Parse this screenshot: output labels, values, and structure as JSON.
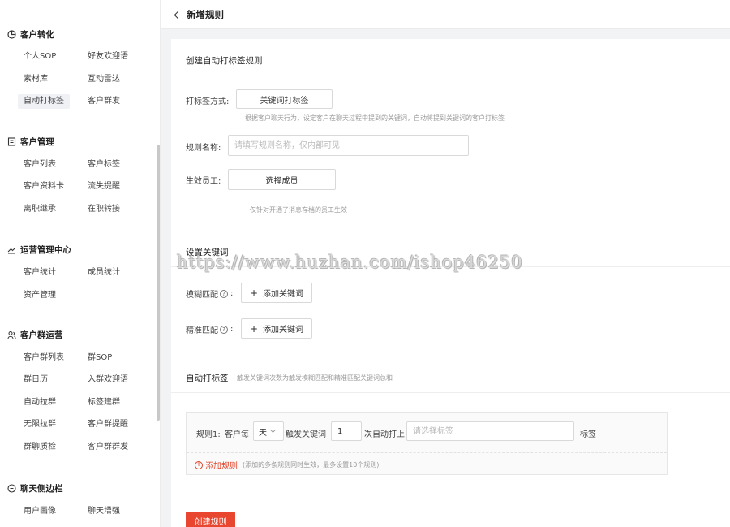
{
  "sidebar": {
    "groups": [
      {
        "title": "客户转化",
        "icon": "chart-icon",
        "items": [
          "个人SOP",
          "好友欢迎语",
          "素材库",
          "互动雷达",
          "自动打标签",
          "客户群发"
        ]
      },
      {
        "title": "客户管理",
        "icon": "list-icon",
        "items": [
          "客户列表",
          "客户标签",
          "客户资料卡",
          "流失提醒",
          "离职继承",
          "在职转接"
        ]
      },
      {
        "title": "运营管理中心",
        "icon": "trend-icon",
        "items": [
          "客户统计",
          "成员统计",
          "资产管理"
        ]
      },
      {
        "title": "客户群运营",
        "icon": "group-icon",
        "items": [
          "客户群列表",
          "群SOP",
          "群日历",
          "入群欢迎语",
          "自动拉群",
          "标签建群",
          "无限拉群",
          "客户群提醒",
          "群聊质检",
          "客户群群发"
        ]
      },
      {
        "title": "聊天侧边栏",
        "icon": "chat-icon",
        "items": [
          "用户画像",
          "聊天增强"
        ]
      }
    ],
    "active_item": "自动打标签"
  },
  "header": {
    "title": "新增规则",
    "back_icon": "chevron-left-icon"
  },
  "form": {
    "section_title": "创建自动打标签规则",
    "tag_method_label": "打标签方式:",
    "tag_method_button": "关键词打标签",
    "tag_method_hint": "根据客户聊天行为，设定客户在聊天过程中提到的关键词，自动将提到关键词的客户打标签",
    "rule_name_label": "规则名称:",
    "rule_name_placeholder": "请填写规则名称，仅内部可见",
    "staff_label": "生效员工:",
    "staff_button": "选择成员",
    "staff_hint": "仅针对开通了消息存档的员工生效",
    "keyword_section_title": "设置关键词",
    "fuzzy_label": "模糊匹配",
    "exact_label": "精准匹配",
    "help_glyph": "?",
    "colon": ":",
    "add_keyword_button": "添加关键词",
    "auto_tag_title": "自动打标签",
    "auto_tag_hint": "触发关键词次数为触发模糊匹配和精准匹配关键词总和",
    "rule": {
      "prefix": "规则1:",
      "every": "客户每",
      "unit": "天",
      "trigger": "触发关键词",
      "count": "1",
      "auto_tag": "次自动打上",
      "tag_placeholder": "请选择标签",
      "suffix": "标签"
    },
    "add_rule_text": "添加规则",
    "add_rule_note": "(添加的多条规则同时生效，最多设置10个规则)",
    "submit_button": "创建规则"
  },
  "watermark": "https://www.huzhan.com/ishop46250",
  "colors": {
    "accent": "#e8462f",
    "active_bg": "#eff1f5"
  }
}
